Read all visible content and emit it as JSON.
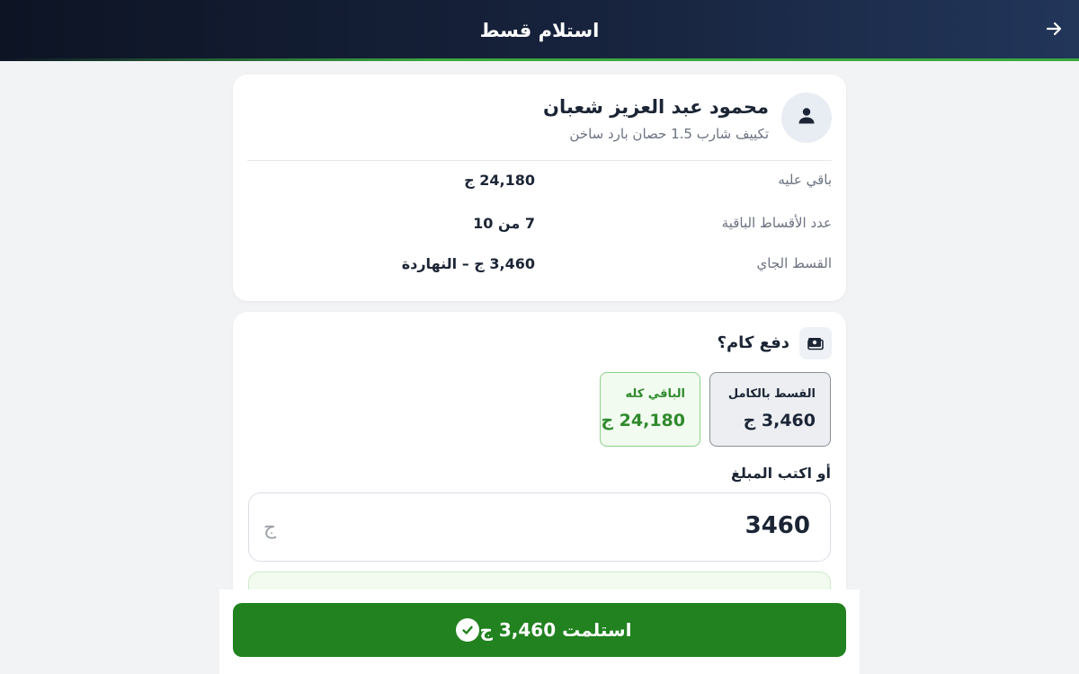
{
  "header": {
    "title": "استلام قسط",
    "back_icon": "arrow-right-icon"
  },
  "customer": {
    "name": "محمود عبد العزيز شعبان",
    "product": "تكييف شارب 1.5 حصان بارد ساخن",
    "avatar_icon": "person-icon"
  },
  "summary": [
    {
      "label": "باقي عليه",
      "value": "24,180 ج"
    },
    {
      "label": "عدد الأقساط الباقية",
      "value": "7 من 10"
    },
    {
      "label": "القسط الجاي",
      "value": "3,460 ج – النهاردة"
    }
  ],
  "payment": {
    "title": "دفع كام؟",
    "title_icon": "cash-icon",
    "options": [
      {
        "label": "القسط بالكامل",
        "value": "3,460 ج",
        "selected": true
      },
      {
        "label": "الباقي كله",
        "value": "24,180 ج",
        "selected": false
      }
    ],
    "custom_label": "أو اكتب المبلغ",
    "amount_value": "3460",
    "currency": "ج"
  },
  "confirm": {
    "label": "استلمت 3,460 ج",
    "icon": "check-circle-icon"
  },
  "colors": {
    "header_dark": "#0d1424",
    "accent_green": "#21821f",
    "soft_green": "#2f8a2c"
  }
}
